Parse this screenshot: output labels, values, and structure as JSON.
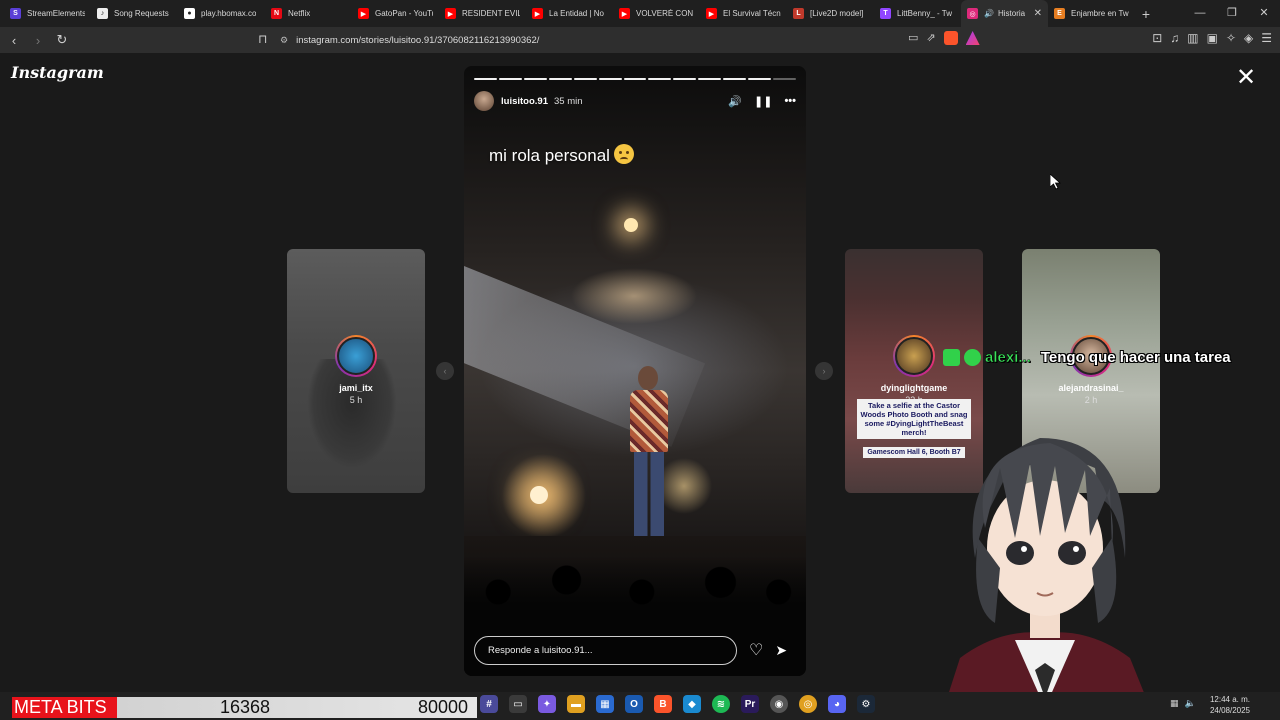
{
  "browser": {
    "tabs": [
      {
        "label": "StreamElements",
        "icon": "streamelements-icon",
        "color": "#5a3fd6",
        "glyph": "S"
      },
      {
        "label": "Song Requests",
        "icon": "song-requests-icon",
        "color": "#eeeeee",
        "glyph": "♪"
      },
      {
        "label": "play.hbomax.co",
        "icon": "hbomax-icon",
        "color": "#ffffff",
        "glyph": "●"
      },
      {
        "label": "Netflix",
        "icon": "netflix-icon",
        "color": "#e50914",
        "glyph": "N"
      },
      {
        "label": "GatoPan - YouTube",
        "icon": "youtube-icon",
        "color": "#ff0000",
        "glyph": "▶"
      },
      {
        "label": "RESIDENT EVIL",
        "icon": "youtube-icon",
        "color": "#ff0000",
        "glyph": "▶"
      },
      {
        "label": "La Entidad | No",
        "icon": "youtube-icon",
        "color": "#ff0000",
        "glyph": "▶"
      },
      {
        "label": "VOLVERÉ CON",
        "icon": "youtube-icon",
        "color": "#ff0000",
        "glyph": "▶"
      },
      {
        "label": "El Survival Técn",
        "icon": "youtube-icon",
        "color": "#ff0000",
        "glyph": "▶"
      },
      {
        "label": "[Live2D model]",
        "icon": "live2d-icon",
        "color": "#c0392b",
        "glyph": "L"
      },
      {
        "label": "LittBenny_ - Tw",
        "icon": "twitch-icon",
        "color": "#9146ff",
        "glyph": "T"
      },
      {
        "label": "Historia",
        "icon": "instagram-icon",
        "color": "#dd2a7b",
        "glyph": "◎",
        "active": true
      },
      {
        "label": "Enjambre en Tw",
        "icon": "bookmark-tab-icon",
        "color": "#e67e22",
        "glyph": "E"
      }
    ],
    "url": "instagram.com/stories/luisitoo.91/3706082116213990362/",
    "window_controls": {
      "minimize": "—",
      "restore": "❐",
      "close": "✕"
    }
  },
  "page": {
    "logo": "Instagram",
    "close_symbol": "✕",
    "arrow_left": "‹",
    "arrow_right": "›",
    "story": {
      "username": "luisitoo.91",
      "time": "35 min",
      "caption": "mi rola personal",
      "caption_emoji": "confused-face-icon",
      "reply_placeholder": "Responde a luisitoo.91...",
      "progress_total": 13,
      "progress_done": 12,
      "icons": {
        "mute": "🔊",
        "pause": "❚❚",
        "more": "•••",
        "like": "♡",
        "send": "➤"
      }
    },
    "previews": [
      {
        "username": "jami_itx",
        "time": "5 h"
      },
      {
        "username": "dyinglightgame",
        "time": "23 h",
        "promo": "Take a selfie at the Castor Woods Photo Booth and snag some #DyingLightTheBeast merch!",
        "promo2": "Gamescom Hall 6, Booth B7"
      },
      {
        "username": "alejandrasinai_",
        "time": "2 h"
      }
    ]
  },
  "overlay": {
    "chat_user": "alexi...",
    "chat_message": "Tengo que hacer una tarea",
    "meta_bits_label": "META BITS",
    "bits_current": "16368",
    "bits_goal": "80000"
  },
  "taskbar": {
    "time": "12:44 a. m.",
    "date": "24/08/2025"
  }
}
